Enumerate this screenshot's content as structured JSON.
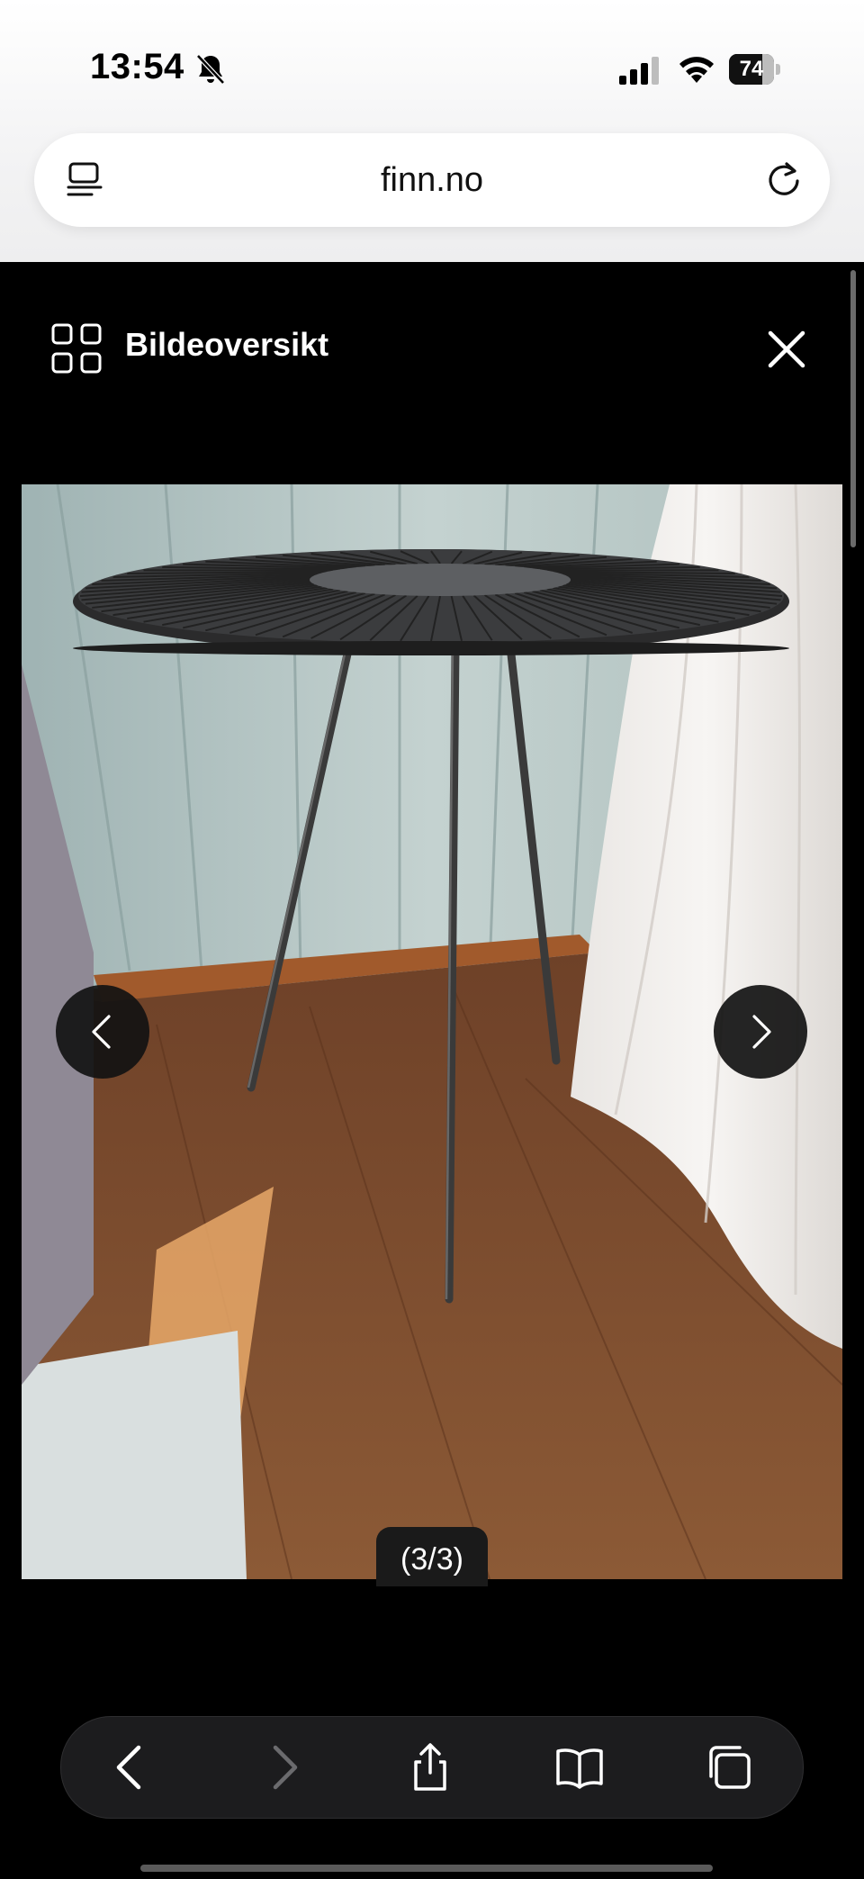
{
  "status_bar": {
    "time": "13:54",
    "battery": "74",
    "battery_level": 0.74,
    "icons": [
      "bell-slash-icon",
      "cellular-signal-icon",
      "wifi-icon",
      "battery-icon"
    ]
  },
  "url_bar": {
    "domain": "finn.no",
    "left_icon": "reader-mode-icon",
    "right_icon": "reload-icon"
  },
  "viewer": {
    "overview_label": "Bildeoversikt",
    "overview_icon": "grid-icon",
    "close_icon": "close-icon",
    "photo_description_icon": "photo-side-table",
    "prev_icon": "chevron-left-icon",
    "next_icon": "chevron-right-icon",
    "counter": "(3/3)"
  },
  "toolbar": {
    "items": [
      "back-icon",
      "forward-icon",
      "share-icon",
      "bookmarks-icon",
      "tabs-icon"
    ],
    "forward_disabled": true
  }
}
